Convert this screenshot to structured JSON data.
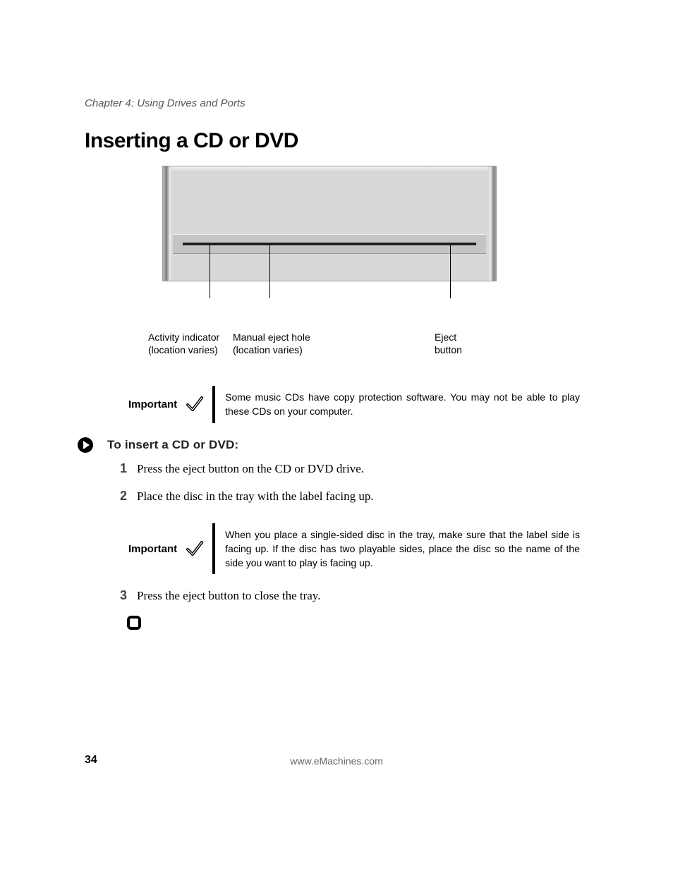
{
  "chapter": "Chapter 4: Using Drives and Ports",
  "title": "Inserting a CD or DVD",
  "diagram": {
    "label_activity": "Activity indicator\n(location varies)",
    "label_manual_eject": "Manual eject hole\n(location varies)",
    "label_eject_button": "Eject\nbutton"
  },
  "callout1": {
    "label": "Important",
    "text": "Some music CDs have copy protection software. You may not be able to play these CDs on your computer."
  },
  "steps_heading": "To insert a CD or DVD:",
  "steps": {
    "s1_num": "1",
    "s1_text": "Press the eject button on the CD or DVD drive.",
    "s2_num": "2",
    "s2_text": "Place the disc in the tray with the label facing up.",
    "s3_num": "3",
    "s3_text": "Press the eject button to close the tray."
  },
  "callout2": {
    "label": "Important",
    "text": "When you place a single-sided disc in the tray, make sure that the label side is facing up. If the disc has two playable sides, place the disc so the name of the side you want to play is facing up."
  },
  "footer_url": "www.eMachines.com",
  "page_number": "34"
}
